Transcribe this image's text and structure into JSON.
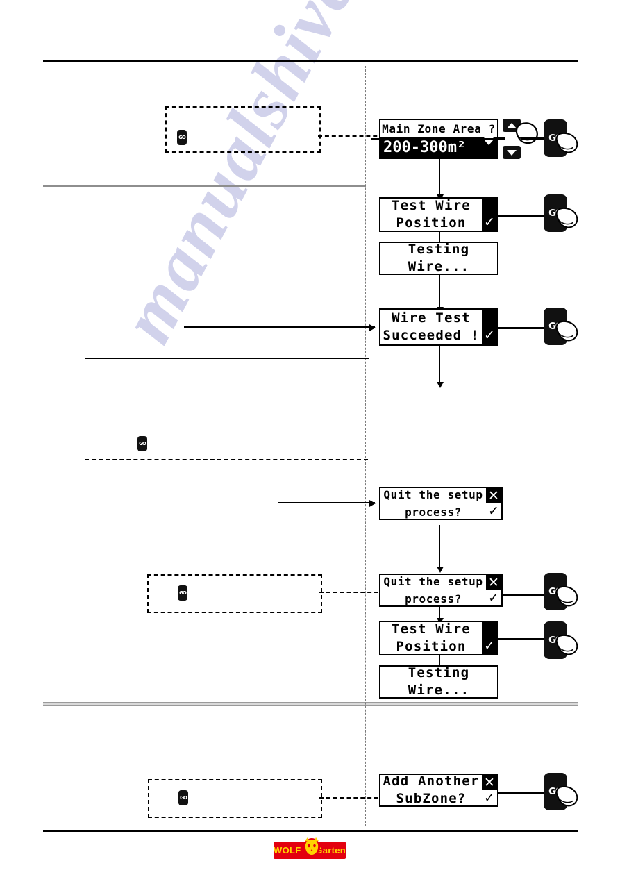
{
  "document": {
    "brand": "WOLF-Garten",
    "logo_left_text": "WOLF",
    "logo_right_text": "Garten",
    "logo_bg_color": "#e3000f",
    "logo_text_color": "#ffd400",
    "watermark_text": "manualshive.com"
  },
  "screens": [
    {
      "id": "main-zone-area",
      "line1": "Main Zone Area ?",
      "line2": "200-300m²",
      "inverted_line": 2,
      "scroll_arrows": [
        "up-triangle",
        "down-triangle"
      ],
      "softkeys": []
    },
    {
      "id": "test-wire-position-1",
      "line1": "Test Wire",
      "line2": "Position",
      "softkeys": [
        {
          "glyph": "✓",
          "style": "black"
        }
      ]
    },
    {
      "id": "testing-wire-1",
      "line1": "Testing",
      "line2": "Wire...",
      "softkeys": []
    },
    {
      "id": "wire-test-succeeded",
      "line1": "Wire Test",
      "line2": "Succeeded !",
      "softkeys": [
        {
          "glyph": "✓",
          "style": "black"
        }
      ]
    },
    {
      "id": "quit-setup-1",
      "line1": "Quit the setup",
      "line2": "process?",
      "softkeys": [
        {
          "glyph": "✕",
          "style": "inverted"
        },
        {
          "glyph": "✓",
          "style": "white"
        }
      ]
    },
    {
      "id": "quit-setup-2",
      "line1": "Quit the setup",
      "line2": "process?",
      "softkeys": [
        {
          "glyph": "✕",
          "style": "inverted"
        },
        {
          "glyph": "✓",
          "style": "white"
        }
      ]
    },
    {
      "id": "test-wire-position-2",
      "line1": "Test Wire",
      "line2": "Position",
      "softkeys": [
        {
          "glyph": "✓",
          "style": "black"
        }
      ]
    },
    {
      "id": "testing-wire-2",
      "line1": "Testing",
      "line2": "Wire...",
      "softkeys": []
    },
    {
      "id": "add-another-subzone",
      "line1": "Add Another",
      "line2": "SubZone?",
      "softkeys": [
        {
          "glyph": "✕",
          "style": "inverted"
        },
        {
          "glyph": "✓",
          "style": "white"
        }
      ]
    }
  ],
  "controls": {
    "go_label": "GO",
    "up_key": "up-arrow",
    "down_key": "down-arrow",
    "hand_icon": "pointing-hand"
  },
  "notes": [
    {
      "id": "note-top",
      "icon": "go-button-icon"
    },
    {
      "id": "note-middle",
      "icon": "go-button-icon"
    },
    {
      "id": "note-lower",
      "icon": "go-button-icon"
    },
    {
      "id": "note-bottom",
      "icon": "go-button-icon"
    }
  ]
}
